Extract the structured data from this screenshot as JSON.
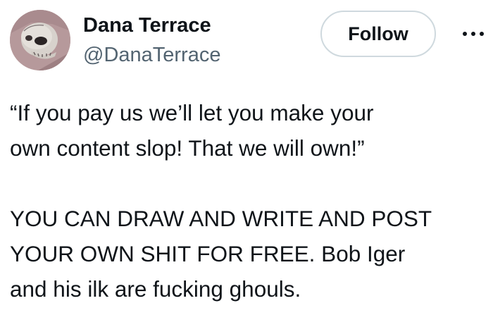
{
  "author": {
    "name": "Dana Terrace",
    "handle": "@DanaTerrace",
    "avatar_icon": "skull-avatar"
  },
  "actions": {
    "follow_label": "Follow",
    "more_icon": "more-horizontal-icon"
  },
  "post": {
    "paragraph1": {
      "line1": "“If you pay us we’ll let you make your",
      "line2": "own content slop! That we will own!”"
    },
    "paragraph2": {
      "line1": "YOU CAN DRAW AND WRITE AND POST",
      "line2": "YOUR OWN SHIT FOR FREE. Bob Iger",
      "line3": "and his ilk are fucking ghouls."
    }
  },
  "colors": {
    "text": "#0f1419",
    "secondary": "#536471",
    "button_border": "#cfd9de"
  }
}
